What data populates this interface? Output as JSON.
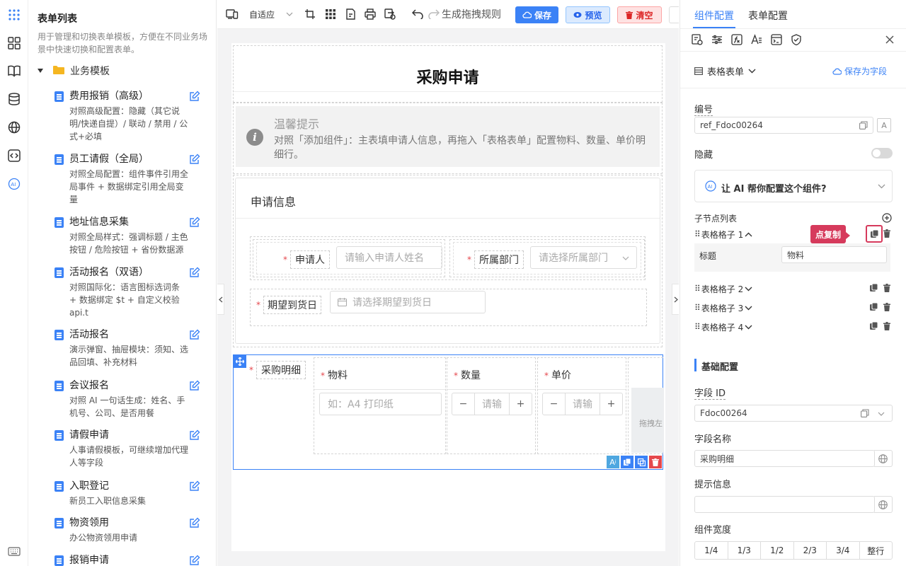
{
  "left_panel": {
    "title": "表单列表",
    "description": "用于管理和切换表单模板，方便在不同业务场景中快速切换和配置表单。",
    "folder": "业务模板",
    "templates": [
      {
        "name": "费用报销（高级）",
        "desc": "对照高级配置：隐藏（其它说明/快递自提）/ 联动 / 禁用 / 公式+必填"
      },
      {
        "name": "员工请假（全局）",
        "desc": "对照全局配置：组件事件引用全局事件 + 数据绑定引用全局变量"
      },
      {
        "name": "地址信息采集",
        "desc": "对照全局样式：强调标题 / 主色按钮 / 危险按钮 + 省份数据源"
      },
      {
        "name": "活动报名（双语）",
        "desc": "对照国际化：语言图标选词条 + 数据绑定 $t + 自定义校验 api.t"
      },
      {
        "name": "活动报名",
        "desc": "演示弹窗、抽屉模块：须知、选品回填、补充材料"
      },
      {
        "name": "会议报名",
        "desc": "对照 AI 一句话生成：姓名、手机号、公司、是否用餐"
      },
      {
        "name": "请假申请",
        "desc": "人事请假模板，可继续增加代理人等字段"
      },
      {
        "name": "入职登记",
        "desc": "新员工入职信息采集"
      },
      {
        "name": "物资领用",
        "desc": "办公物资领用申请"
      },
      {
        "name": "报销申请",
        "desc": ""
      }
    ]
  },
  "toolbar": {
    "layout_mode": "自适应",
    "generate_rules": "生成拖拽规则",
    "save": "保存",
    "preview": "预览",
    "clear": "清空"
  },
  "form": {
    "title": "采购申请",
    "notice_title": "温馨提示",
    "notice_text": "对照「添加组件」：主表填申请人信息，再拖入「表格表单」配置物料、数量、单价明细行。",
    "section_title": "申请信息",
    "applicant_label": "申请人",
    "applicant_placeholder": "请输入申请人姓名",
    "dept_label": "所属部门",
    "dept_placeholder": "请选择所属部门",
    "date_label": "期望到货日",
    "date_placeholder": "请选择期望到货日",
    "table_label": "采购明细",
    "columns": [
      "物料",
      "数量",
      "单价"
    ],
    "material_placeholder": "如：A4 打印纸",
    "qty_placeholder": "请输",
    "price_placeholder": "请输",
    "drag_hint": "拖拽左"
  },
  "right_panel": {
    "tabs": [
      "组件配置",
      "表单配置"
    ],
    "component_type": "表格表单",
    "save_as_field": "保存为字段",
    "id_label": "编号",
    "id_value": "ref_Fdoc00264",
    "hidden_label": "隐藏",
    "ai_prompt": "让 AI 帮你配置这个组件?",
    "children_label": "子节点列表",
    "children": [
      "表格格子 1",
      "表格格子 2",
      "表格格子 3",
      "表格格子 4"
    ],
    "child_title_label": "标题",
    "child_title_value": "物料",
    "copy_tooltip": "点复制",
    "basic_config": "基础配置",
    "field_id_label": "字段 ID",
    "field_id_value": "Fdoc00264",
    "field_name_label": "字段名称",
    "field_name_value": "采购明细",
    "hint_label": "提示信息",
    "hint_value": "",
    "width_label": "组件宽度",
    "width_options": [
      "1/4",
      "1/3",
      "1/2",
      "2/3",
      "3/4",
      "整行"
    ]
  },
  "colors": {
    "primary": "#3b82f6",
    "danger": "#e5484d",
    "tooltip": "#d63a5c"
  }
}
